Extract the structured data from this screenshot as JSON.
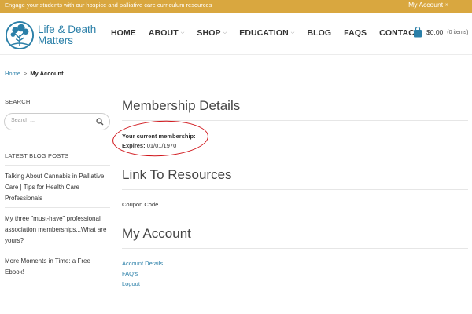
{
  "topbar": {
    "promo": "Engage your students with our hospice and palliative care curriculum resources",
    "account_label": "My Account",
    "account_chevron": "»"
  },
  "header": {
    "logo_text_line1": "Life & Death",
    "logo_text_line2": "Matters",
    "logo_icon": "tree-icon",
    "nav": [
      {
        "label": "HOME",
        "has_dropdown": false
      },
      {
        "label": "ABOUT",
        "has_dropdown": true
      },
      {
        "label": "SHOP",
        "has_dropdown": true
      },
      {
        "label": "EDUCATION",
        "has_dropdown": true
      },
      {
        "label": "BLOG",
        "has_dropdown": false
      },
      {
        "label": "FAQS",
        "has_dropdown": false
      },
      {
        "label": "CONTACT",
        "has_dropdown": false
      }
    ],
    "cart": {
      "icon": "shopping-bag-icon",
      "total": "$0.00",
      "count": "(0 items)"
    }
  },
  "breadcrumb": {
    "home": "Home",
    "separator": ">",
    "current": "My Account"
  },
  "sidebar": {
    "search_heading": "SEARCH",
    "search_placeholder": "Search ...",
    "blog_heading": "LATEST BLOG POSTS",
    "posts": [
      "Talking About Cannabis in Palliative Care | Tips for Health Care Professionals",
      "My three \"must-have\" professional association memberships...What are yours?",
      "More Moments in Time: a Free Ebook!"
    ]
  },
  "main": {
    "membership_heading": "Membership Details",
    "current_membership_label": "Your current membership:",
    "expires_label": "Expires:",
    "expires_value": "01/01/1970",
    "resources_heading": "Link To Resources",
    "coupon_label": "Coupon Code",
    "account_heading": "My Account",
    "account_links": [
      "Account Details",
      "FAQ's",
      "Logout"
    ]
  },
  "colors": {
    "topbar": "#d9a73f",
    "brand_blue": "#2a7fa8",
    "annotation_red": "#d0151a"
  }
}
